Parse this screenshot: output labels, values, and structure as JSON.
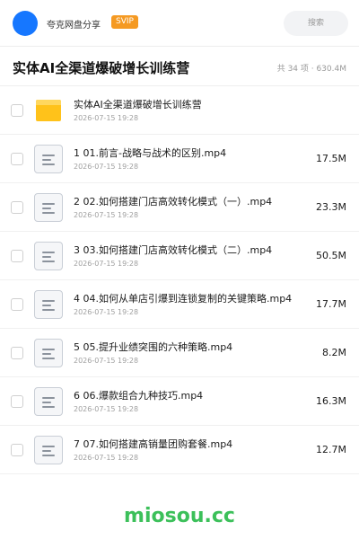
{
  "header": {
    "user_name": "夸克网盘分享",
    "badge": "SVIP",
    "search_placeholder": "搜索",
    "accent_color": "#1677ff"
  },
  "folder": {
    "title": "实体AI全渠道爆破增长训练营",
    "summary": "共 34 项 · 630.4M"
  },
  "files": [
    {
      "type": "folder",
      "name": "实体AI全渠道爆破增长训练营",
      "date": "2026-07-15 19:28",
      "size": ""
    },
    {
      "type": "video",
      "name": "1 01.前言-战略与战术的区别.mp4",
      "date": "2026-07-15 19:28",
      "size": "17.5M"
    },
    {
      "type": "video",
      "name": "2 02.如何搭建门店高效转化模式（一）.mp4",
      "date": "2026-07-15 19:28",
      "size": "23.3M"
    },
    {
      "type": "video",
      "name": "3 03.如何搭建门店高效转化模式（二）.mp4",
      "date": "2026-07-15 19:28",
      "size": "50.5M"
    },
    {
      "type": "video",
      "name": "4 04.如何从单店引爆到连锁复制的关键策略.mp4",
      "date": "2026-07-15 19:28",
      "size": "17.7M"
    },
    {
      "type": "video",
      "name": "5 05.提升业绩突围的六种策略.mp4",
      "date": "2026-07-15 19:28",
      "size": "8.2M"
    },
    {
      "type": "video",
      "name": "6 06.爆款组合九种技巧.mp4",
      "date": "2026-07-15 19:28",
      "size": "16.3M"
    },
    {
      "type": "video",
      "name": "7 07.如何搭建高销量团购套餐.mp4",
      "date": "2026-07-15 19:28",
      "size": "12.7M"
    }
  ],
  "watermark": "miosou.cc"
}
